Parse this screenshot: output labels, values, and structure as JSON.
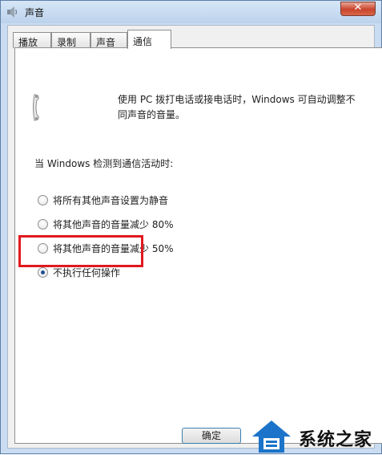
{
  "window": {
    "title": "声音",
    "close_label": "✕"
  },
  "tabs": [
    {
      "label": "播放"
    },
    {
      "label": "录制"
    },
    {
      "label": "声音"
    },
    {
      "label": "通信"
    }
  ],
  "communications": {
    "description": "使用 PC 拨打电话或接电话时，Windows 可自动调整不同声音的音量。",
    "when_label": "当 Windows 检测到通信活动时:",
    "options": [
      {
        "label": "将所有其他声音设置为静音",
        "checked": false
      },
      {
        "label": "将其他声音的音量减少 80%",
        "checked": false
      },
      {
        "label": "将其他声音的音量减少 50%",
        "checked": false
      },
      {
        "label": "不执行任何操作",
        "checked": true
      }
    ]
  },
  "buttons": {
    "ok_label": "确定"
  },
  "watermark": {
    "text": "系统之家"
  },
  "colors": {
    "highlight": "#e0191f",
    "radio_dot": "#1d4f91",
    "titlebar": "#c9dcf1"
  }
}
